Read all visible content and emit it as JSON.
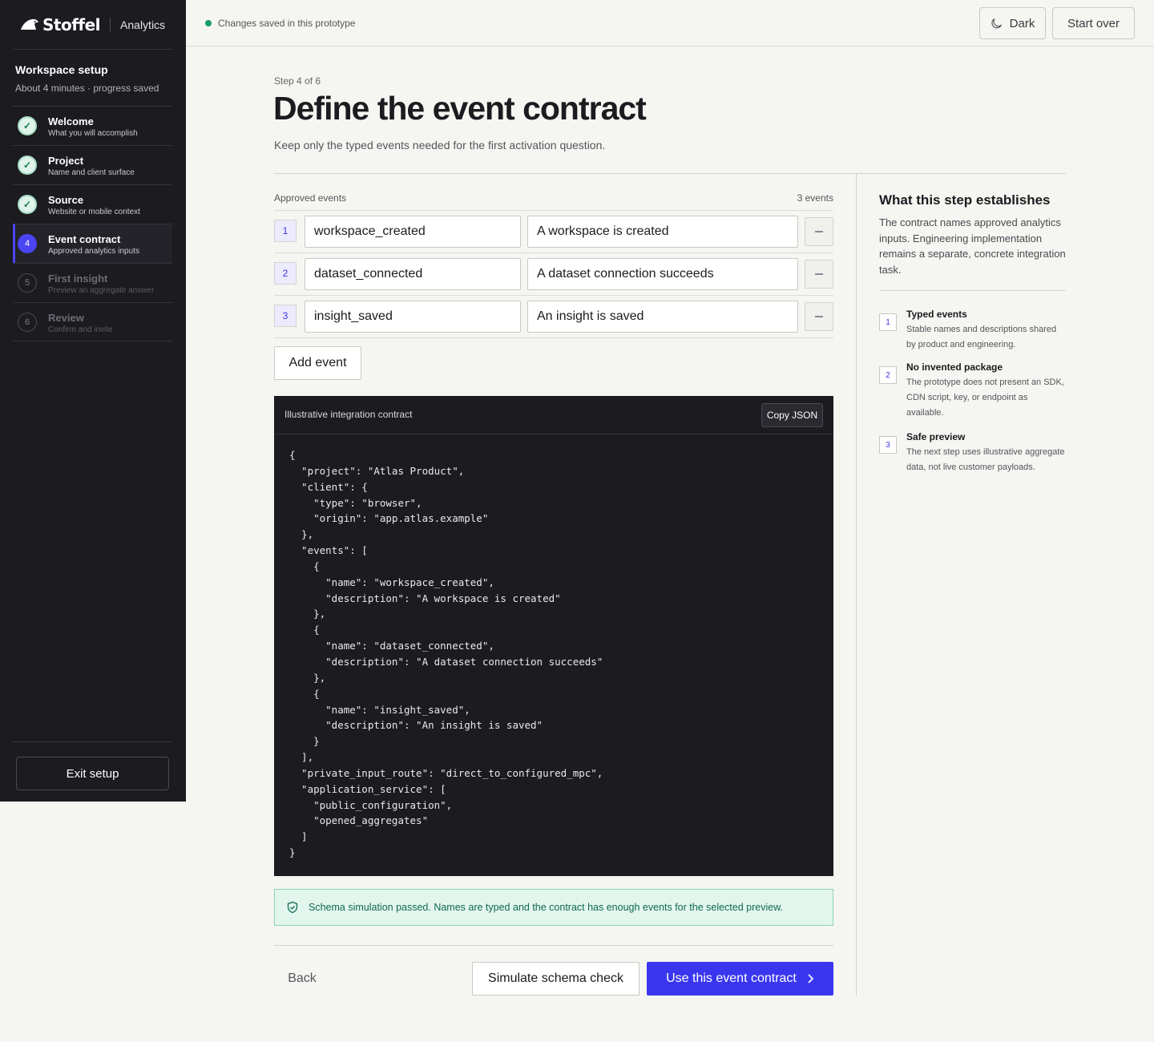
{
  "brand": {
    "name": "Stoffel",
    "product": "Analytics"
  },
  "workspace": {
    "title": "Workspace setup",
    "subtitle": "About 4 minutes · progress saved"
  },
  "steps": [
    {
      "num": "1",
      "name": "Welcome",
      "desc": "What you will accomplish",
      "state": "done"
    },
    {
      "num": "2",
      "name": "Project",
      "desc": "Name and client surface",
      "state": "done"
    },
    {
      "num": "3",
      "name": "Source",
      "desc": "Website or mobile context",
      "state": "done"
    },
    {
      "num": "4",
      "name": "Event contract",
      "desc": "Approved analytics inputs",
      "state": "current"
    },
    {
      "num": "5",
      "name": "First insight",
      "desc": "Preview an aggregate answer",
      "state": "todo"
    },
    {
      "num": "6",
      "name": "Review",
      "desc": "Confirm and invite",
      "state": "todo"
    }
  ],
  "check_glyph": "✓",
  "exit_label": "Exit setup",
  "topbar": {
    "saved_text": "Changes saved in this prototype",
    "dark_label": "Dark",
    "start_over_label": "Start over"
  },
  "header": {
    "step_count": "Step 4 of 6",
    "title": "Define the event contract",
    "subtitle": "Keep only the typed events needed for the first activation question."
  },
  "events_section": {
    "label": "Approved events",
    "count": "3 events",
    "events": [
      {
        "num": "1",
        "name": "workspace_created",
        "description": "A workspace is created"
      },
      {
        "num": "2",
        "name": "dataset_connected",
        "description": "A dataset connection succeeds"
      },
      {
        "num": "3",
        "name": "insight_saved",
        "description": "An insight is saved"
      }
    ],
    "add_label": "Add event"
  },
  "code": {
    "title": "Illustrative integration contract",
    "copy_label": "Copy JSON",
    "content": "{\n  \"project\": \"Atlas Product\",\n  \"client\": {\n    \"type\": \"browser\",\n    \"origin\": \"app.atlas.example\"\n  },\n  \"events\": [\n    {\n      \"name\": \"workspace_created\",\n      \"description\": \"A workspace is created\"\n    },\n    {\n      \"name\": \"dataset_connected\",\n      \"description\": \"A dataset connection succeeds\"\n    },\n    {\n      \"name\": \"insight_saved\",\n      \"description\": \"An insight is saved\"\n    }\n  ],\n  \"private_input_route\": \"direct_to_configured_mpc\",\n  \"application_service\": [\n    \"public_configuration\",\n    \"opened_aggregates\"\n  ]\n}"
  },
  "success_message": "Schema simulation passed. Names are typed and the contract has enough events for the selected preview.",
  "footer": {
    "back_label": "Back",
    "simulate_label": "Simulate schema check",
    "use_label": "Use this event contract"
  },
  "right_panel": {
    "title": "What this step establishes",
    "text": "The contract names approved analytics inputs. Engineering implementation remains a separate, concrete integration task.",
    "items": [
      {
        "num": "1",
        "title": "Typed events",
        "text": "Stable names and descriptions shared by product and engineering."
      },
      {
        "num": "2",
        "title": "No invented package",
        "text": "The prototype does not present an SDK, CDN script, key, or endpoint as available."
      },
      {
        "num": "3",
        "title": "Safe preview",
        "text": "The next step uses illustrative aggregate data, not live customer payloads."
      }
    ]
  },
  "colors": {
    "accent": "#3a36f0",
    "success": "#149a72",
    "sidebar": "#1b1b20",
    "background": "#f5f5f1"
  }
}
